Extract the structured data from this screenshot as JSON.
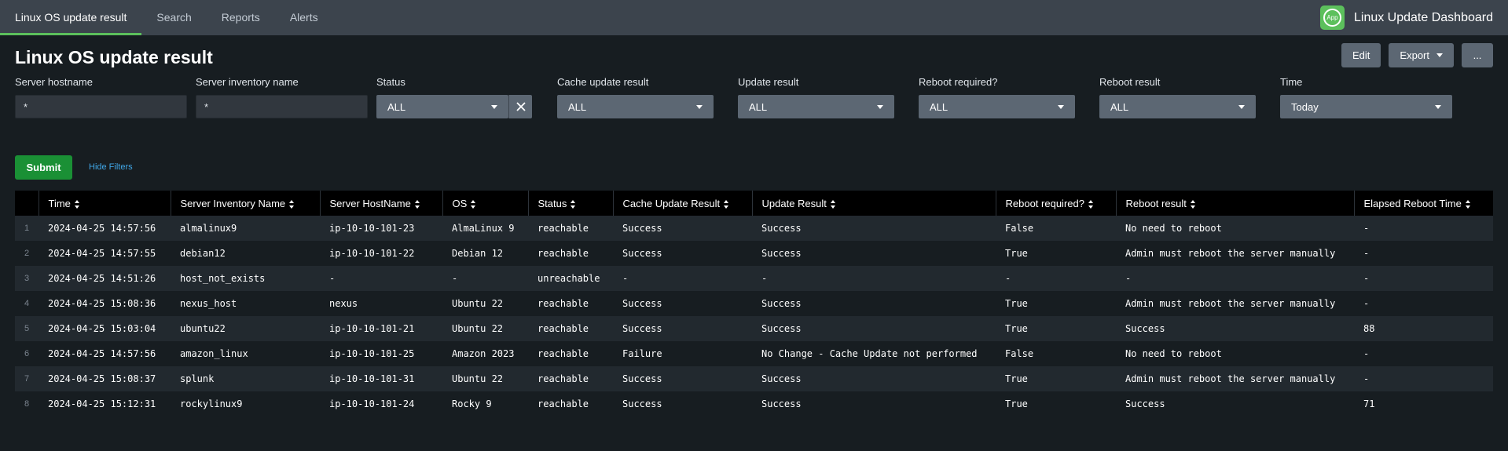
{
  "nav": {
    "items": [
      "Linux OS update result",
      "Search",
      "Reports",
      "Alerts"
    ]
  },
  "brand": {
    "icon_text": "App",
    "title": "Linux Update Dashboard"
  },
  "page": {
    "title": "Linux OS update result"
  },
  "actions": {
    "edit": "Edit",
    "export": "Export",
    "more": "..."
  },
  "filters": {
    "hostname": {
      "label": "Server hostname",
      "value": "*"
    },
    "inventory": {
      "label": "Server inventory name",
      "value": "*"
    },
    "status": {
      "label": "Status",
      "value": "ALL"
    },
    "cache": {
      "label": "Cache update result",
      "value": "ALL"
    },
    "update": {
      "label": "Update result",
      "value": "ALL"
    },
    "reboot_required": {
      "label": "Reboot required?",
      "value": "ALL"
    },
    "reboot_result": {
      "label": "Reboot result",
      "value": "ALL"
    },
    "time": {
      "label": "Time",
      "value": "Today"
    }
  },
  "submit_label": "Submit",
  "hide_filters_label": "Hide Filters",
  "table": {
    "columns": [
      "Time",
      "Server Inventory Name",
      "Server HostName",
      "OS",
      "Status",
      "Cache Update Result",
      "Update Result",
      "Reboot required?",
      "Reboot result",
      "Elapsed Reboot Time"
    ],
    "rows": [
      {
        "num": "1",
        "cells": [
          "2024-04-25 14:57:56",
          "almalinux9",
          "ip-10-10-101-23",
          "AlmaLinux 9",
          "reachable",
          "Success",
          "Success",
          "False",
          "No need to reboot",
          "-"
        ]
      },
      {
        "num": "2",
        "cells": [
          "2024-04-25 14:57:55",
          "debian12",
          "ip-10-10-101-22",
          "Debian 12",
          "reachable",
          "Success",
          "Success",
          "True",
          "Admin must reboot the server manually",
          "-"
        ]
      },
      {
        "num": "3",
        "cells": [
          "2024-04-25 14:51:26",
          "host_not_exists",
          "-",
          "-",
          "unreachable",
          "-",
          "-",
          "-",
          "-",
          "-"
        ]
      },
      {
        "num": "4",
        "cells": [
          "2024-04-25 15:08:36",
          "nexus_host",
          "nexus",
          "Ubuntu 22",
          "reachable",
          "Success",
          "Success",
          "True",
          "Admin must reboot the server manually",
          "-"
        ]
      },
      {
        "num": "5",
        "cells": [
          "2024-04-25 15:03:04",
          "ubuntu22",
          "ip-10-10-101-21",
          "Ubuntu 22",
          "reachable",
          "Success",
          "Success",
          "True",
          "Success",
          "88"
        ]
      },
      {
        "num": "6",
        "cells": [
          "2024-04-25 14:57:56",
          "amazon_linux",
          "ip-10-10-101-25",
          "Amazon 2023",
          "reachable",
          "Failure",
          "No Change - Cache Update not performed",
          "False",
          "No need to reboot",
          "-"
        ]
      },
      {
        "num": "7",
        "cells": [
          "2024-04-25 15:08:37",
          "splunk",
          "ip-10-10-101-31",
          "Ubuntu 22",
          "reachable",
          "Success",
          "Success",
          "True",
          "Admin must reboot the server manually",
          "-"
        ]
      },
      {
        "num": "8",
        "cells": [
          "2024-04-25 15:12:31",
          "rockylinux9",
          "ip-10-10-101-24",
          "Rocky 9",
          "reachable",
          "Success",
          "Success",
          "True",
          "Success",
          "71"
        ]
      }
    ]
  },
  "colors": {
    "topbar": "#3c444d",
    "background": "#171d21",
    "accent_green": "#5cc05c",
    "submit_green": "#1a9035",
    "link_blue": "#40a6e6"
  }
}
